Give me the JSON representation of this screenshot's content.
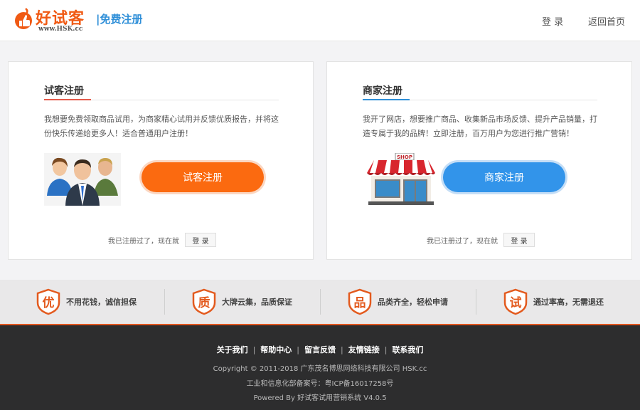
{
  "header": {
    "logo_text": "好试客",
    "logo_sub": "www.HSK.cc",
    "page_tag": "|免费注册",
    "nav": {
      "login": "登 录",
      "home": "返回首页"
    }
  },
  "cards": {
    "tester": {
      "title": "试客注册",
      "description": "我想要免费领取商品试用，为商家精心试用并反馈优质报告，并将这份快乐传递给更多人！适合普通用户注册！",
      "button": "试客注册",
      "footer_text": "我已注册过了，现在就",
      "login_button": "登 录"
    },
    "merchant": {
      "title": "商家注册",
      "description": "我开了网店，想要推广商品、收集新品市场反馈、提升产品销量，打造专属于我的品牌！立即注册，百万用户为您进行推广营销！",
      "button": "商家注册",
      "footer_text": "我已注册过了，现在就",
      "login_button": "登 录",
      "shop_sign": "SHOP"
    }
  },
  "features": [
    {
      "icon_char": "优",
      "text": "不用花钱，诚信担保"
    },
    {
      "icon_char": "质",
      "text": "大牌云集，品质保证"
    },
    {
      "icon_char": "品",
      "text": "品类齐全，轻松申请"
    },
    {
      "icon_char": "试",
      "text": "通过率高，无需退还"
    }
  ],
  "footer": {
    "links": [
      "关于我们",
      "帮助中心",
      "留言反馈",
      "友情链接",
      "联系我们"
    ],
    "copyright": "Copyright © 2011-2018 广东茂名博思网络科技有限公司 HSK.cc",
    "icp": "工业和信息化部备案号：粤ICP备16017258号",
    "powered": "Powered By 好试客试用营销系统 V4.0.5"
  },
  "colors": {
    "brand_orange": "#f05a14",
    "accent_blue": "#2f8fd8",
    "tester_button": "#fb6a10",
    "merchant_button": "#3294ea",
    "footer_bg": "#2d2d2e"
  }
}
